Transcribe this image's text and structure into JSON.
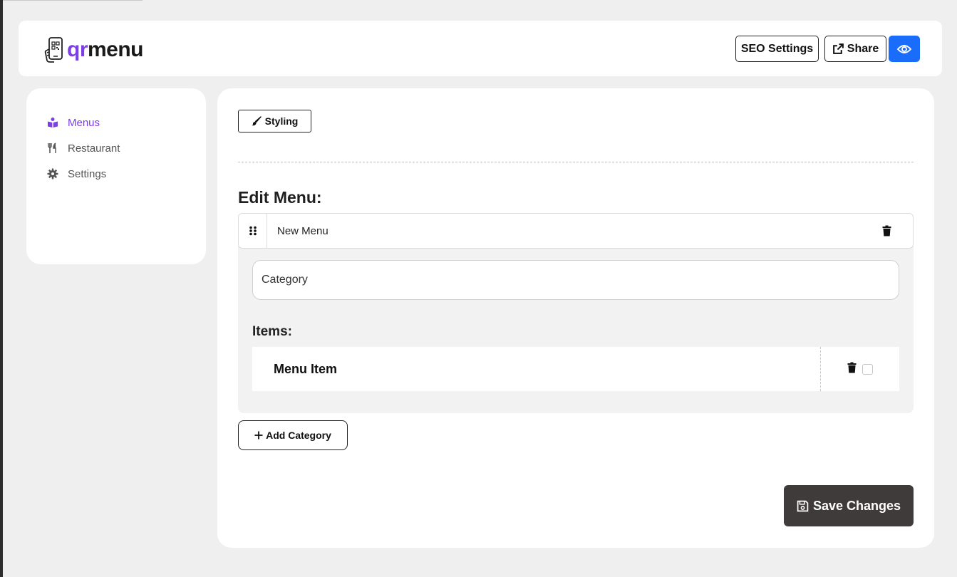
{
  "brand": {
    "logo_part1": "qr",
    "logo_part2": "menu",
    "accent_color": "#7b3fe4",
    "logo_icon": "phone-qr-icon"
  },
  "header": {
    "seo_label": "SEO Settings",
    "share_label": "Share",
    "share_icon": "external-link-icon",
    "preview_icon": "eye-icon",
    "preview_color": "#1a6dfb"
  },
  "sidebar": {
    "items": [
      {
        "label": "Menus",
        "icon": "book-icon",
        "active": true
      },
      {
        "label": "Restaurant",
        "icon": "utensils-icon",
        "active": false
      },
      {
        "label": "Settings",
        "icon": "gear-icon",
        "active": false
      }
    ]
  },
  "main": {
    "styling_label": "Styling",
    "styling_icon": "paintbrush-icon",
    "edit_title": "Edit Menu:",
    "menu": {
      "name": "New Menu",
      "category_value": "Category",
      "items_title": "Items:",
      "items": [
        {
          "name": "Menu Item",
          "checked": false
        }
      ]
    },
    "add_category_label": "Add Category",
    "save_label": "Save Changes",
    "save_color": "#3f3b3a"
  }
}
